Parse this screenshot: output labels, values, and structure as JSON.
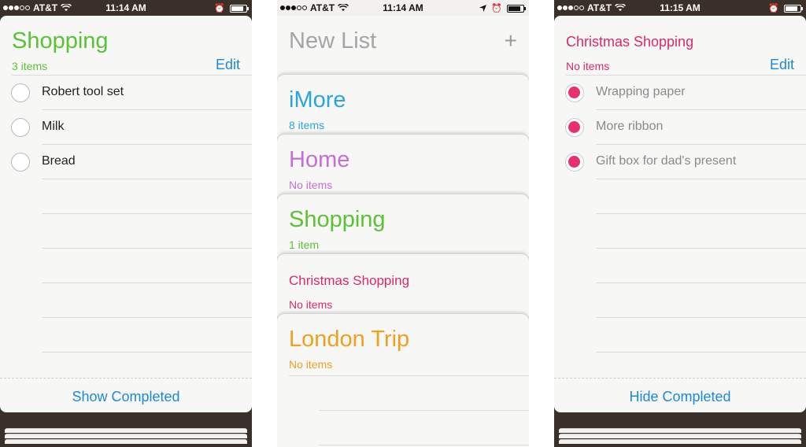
{
  "status": {
    "carrier": "AT&T",
    "time_left": "11:14 AM",
    "time_middle": "11:14 AM",
    "time_right": "11:15 AM"
  },
  "colors": {
    "green": "#5bc236",
    "blue": "#29a6dc",
    "purple": "#c86dd7",
    "pink": "#e0266a",
    "orange": "#f0a020",
    "link": "#1a8ad6"
  },
  "left": {
    "title": "Shopping",
    "count": "3 items",
    "edit": "Edit",
    "items": [
      "Robert tool set",
      "Milk",
      "Bread"
    ],
    "footer": "Show Completed"
  },
  "middle": {
    "new_list": "New List",
    "plus": "+",
    "lists": [
      {
        "title": "iMore",
        "count": "8 items"
      },
      {
        "title": "Home",
        "count": "No items"
      },
      {
        "title": "Shopping",
        "count": "1 item"
      },
      {
        "title": "Christmas Shopping",
        "count": "No items"
      },
      {
        "title": "London Trip",
        "count": "No items"
      }
    ]
  },
  "right": {
    "title": "Christmas Shopping",
    "count": "No items",
    "edit": "Edit",
    "items": [
      "Wrapping paper",
      "More ribbon",
      "Gift box for dad's present"
    ],
    "footer": "Hide Completed"
  }
}
